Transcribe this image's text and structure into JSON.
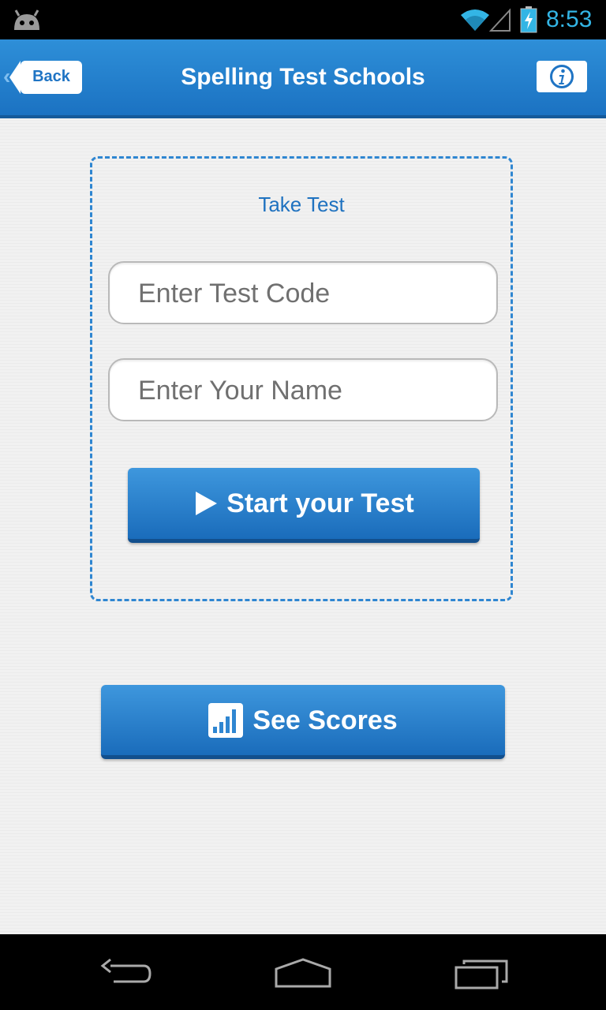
{
  "status_bar": {
    "time": "8:53",
    "icons": [
      "android-icon",
      "wifi-icon",
      "signal-icon",
      "battery-charging-icon"
    ]
  },
  "header": {
    "back_label": "Back",
    "title": "Spelling Test Schools",
    "info_icon": "info-icon"
  },
  "test_panel": {
    "title": "Take Test",
    "code_placeholder": "Enter Test Code",
    "name_placeholder": "Enter Your Name",
    "start_label": "Start your Test",
    "start_icon": "play-icon"
  },
  "scores": {
    "label": "See Scores",
    "icon": "bar-chart-icon"
  },
  "nav_bar": {
    "icons": [
      "back-icon",
      "home-icon",
      "recents-icon"
    ]
  },
  "colors": {
    "accent": "#1f74c4",
    "status_clock": "#33b5e5"
  }
}
